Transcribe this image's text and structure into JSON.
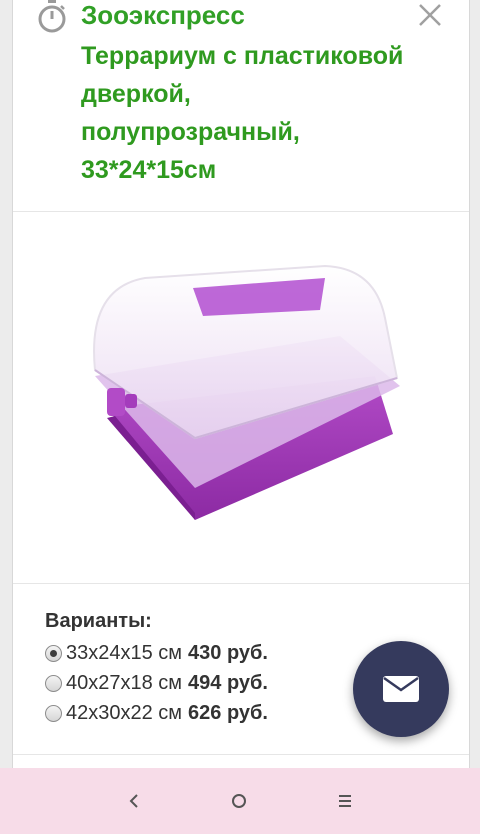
{
  "header": {
    "shop_name": "Зооэкспресс",
    "product_title": "Террариум с пластиковой дверкой, полупрозрачный, 33*24*15см"
  },
  "variants": {
    "title": "Варианты:",
    "options": [
      {
        "size": "33x24x15 см",
        "price": "430 руб.",
        "selected": true
      },
      {
        "size": "40x27x18 см",
        "price": "494 руб.",
        "selected": false
      },
      {
        "size": "42x30x22 см",
        "price": "626 руб.",
        "selected": false
      }
    ]
  },
  "colors": {
    "brand_green": "#31a026",
    "fab_background": "#353a5d",
    "navbar_background": "#f7dce8"
  },
  "icons": {
    "header": "timer-icon",
    "close": "close-icon",
    "fab": "mail-icon",
    "nav": [
      "back-icon",
      "home-icon",
      "menu-icon"
    ]
  }
}
